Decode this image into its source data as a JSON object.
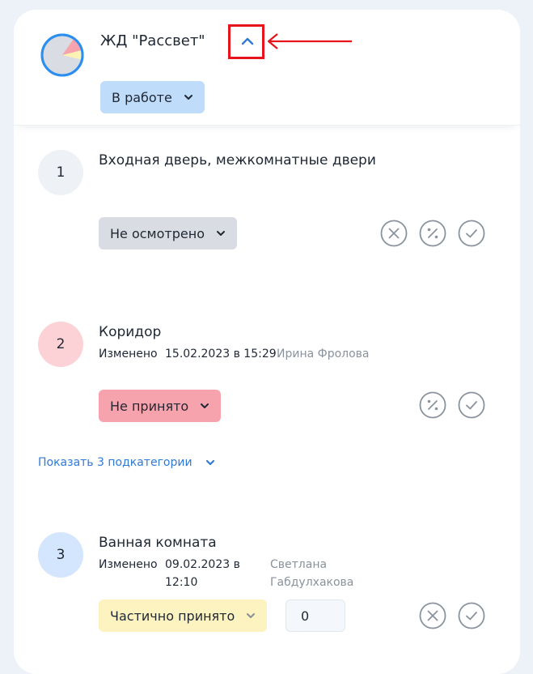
{
  "header": {
    "title": "ЖД \"Рассвет\"",
    "status": "В работе",
    "colors": {
      "pie_base": "#d9dde3",
      "pie_ring": "#2b8ef0",
      "pie_red": "#f7a3ad",
      "pie_yellow": "#fbf2b4"
    }
  },
  "items": [
    {
      "number": "1",
      "title": "Входная дверь, межкомнатные двери",
      "status": "Не осмотрено",
      "status_color": "#d9dde3",
      "circle_color": "#eef1f5"
    },
    {
      "number": "2",
      "title": "Коридор",
      "changed_label": "Изменено",
      "date": "15.02.2023 в 15:29",
      "author": "Ирина Фролова",
      "status": "Не принято",
      "status_color": "#f7a3ad",
      "circle_color": "#fdd2d6",
      "subcategories_link": "Показать 3 подкатегории"
    },
    {
      "number": "3",
      "title": "Ванная комната",
      "changed_label": "Изменено",
      "date_line1": "09.02.2023 в",
      "date_line2": "12:10",
      "author_line1": "Светлана",
      "author_line2": "Габдулхакова",
      "status": "Частично принято",
      "status_color": "#fcf3c0",
      "circle_color": "#d3e6fd",
      "quantity": "0"
    }
  ],
  "icons": [
    "pie-chart-icon",
    "chevron-up-icon",
    "chevron-down-icon",
    "close-circle-icon",
    "percent-circle-icon",
    "check-circle-icon"
  ]
}
